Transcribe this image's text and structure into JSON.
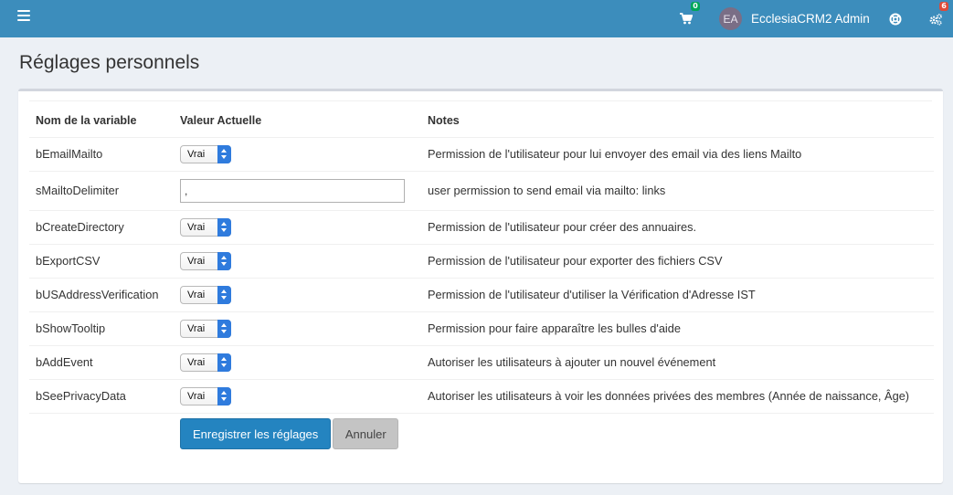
{
  "navbar": {
    "cart_badge": "0",
    "user_initials": "EA",
    "user_name": "EcclesiaCRM2 Admin",
    "settings_badge": "6",
    "colors": {
      "bar": "#3c8dbc",
      "badge_green": "#00a65a",
      "badge_red": "#dd4b39"
    }
  },
  "page": {
    "title": "Réglages personnels"
  },
  "table": {
    "headers": [
      "Nom de la variable",
      "Valeur Actuelle",
      "Notes"
    ],
    "rows": [
      {
        "name": "bEmailMailto",
        "type": "select",
        "value": "Vrai",
        "note": "Permission de l'utilisateur pour lui envoyer des email via des liens Mailto"
      },
      {
        "name": "sMailtoDelimiter",
        "type": "text",
        "value": ",",
        "note": "user permission to send email via mailto: links"
      },
      {
        "name": "bCreateDirectory",
        "type": "select",
        "value": "Vrai",
        "note": "Permission de l'utilisateur pour créer des annuaires."
      },
      {
        "name": "bExportCSV",
        "type": "select",
        "value": "Vrai",
        "note": "Permission de l'utilisateur pour exporter des fichiers CSV"
      },
      {
        "name": "bUSAddressVerification",
        "type": "select",
        "value": "Vrai",
        "note": "Permission de l'utilisateur d'utiliser la Vérification d'Adresse IST"
      },
      {
        "name": "bShowTooltip",
        "type": "select",
        "value": "Vrai",
        "note": "Permission pour faire apparaître les bulles d'aide"
      },
      {
        "name": "bAddEvent",
        "type": "select",
        "value": "Vrai",
        "note": "Autoriser les utilisateurs à ajouter un nouvel événement"
      },
      {
        "name": "bSeePrivacyData",
        "type": "select",
        "value": "Vrai",
        "note": "Autoriser les utilisateurs à voir les données privées des membres (Année de naissance, Âge)"
      }
    ]
  },
  "actions": {
    "save_label": "Enregistrer les réglages",
    "cancel_label": "Annuler"
  }
}
